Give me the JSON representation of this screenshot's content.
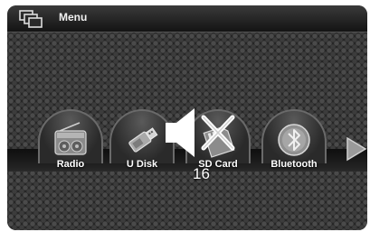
{
  "titlebar": {
    "title": "Menu",
    "icon": "menu-windows-icon"
  },
  "apps": [
    {
      "label": "Radio",
      "icon": "radio-icon"
    },
    {
      "label": "U Disk",
      "icon": "usb-disk-icon"
    },
    {
      "label": "SD Card",
      "icon": "sd-card-icon"
    },
    {
      "label": "Bluetooth",
      "icon": "bluetooth-icon"
    }
  ],
  "navigation": {
    "next_icon": "right-arrow-icon"
  },
  "volume": {
    "level": "16",
    "state": "muted",
    "icon": "speaker-muted-icon"
  }
}
